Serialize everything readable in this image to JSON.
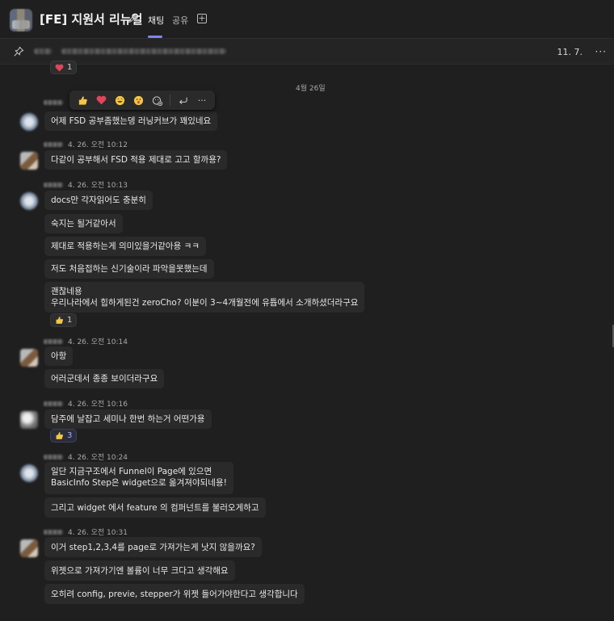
{
  "header": {
    "title": "[FE] 지원서 리뉴얼",
    "tabs": [
      {
        "label": "채팅",
        "active": true
      },
      {
        "label": "공유",
        "active": false
      }
    ],
    "add_tab_symbol": "+"
  },
  "pinned": {
    "date": "11. 7.",
    "more": "···"
  },
  "top_reaction": {
    "emoji": "heart",
    "count": "1"
  },
  "date_divider": "4월 26일",
  "toolbar": {
    "icons": [
      "thumbs-up-icon",
      "heart-icon",
      "laugh-icon",
      "surprised-icon",
      "add-reaction-icon",
      "reply-icon",
      "more-icon"
    ]
  },
  "messages": [
    {
      "time": "",
      "bubbles": [
        "어제 FSD 공부좀했는뎅 러닝커브가 꽤있네요"
      ]
    },
    {
      "time": "4. 26. 오전 10:12",
      "bubbles": [
        "다같이 공부해서 FSD 적용 제대로 고고 할까용?"
      ]
    },
    {
      "time": "4. 26. 오전 10:13",
      "bubbles": [
        "docs만 각자읽어도 충분히",
        "숙지는 될거같아서",
        "제대로 적용하는게 의미있을거같아용 ㅋㅋ",
        "저도 처음접하는 신기술이라 파악을못했는데",
        "괜찮네용",
        "우리나라에서 힙하게된건 zeroCho? 이분이 3~4개월전에 유튭에서 소개하셨더라구요"
      ],
      "reaction": {
        "emoji": "thumbs-up",
        "count": "1"
      }
    },
    {
      "time": "4. 26. 오전 10:14",
      "bubbles": [
        "아항",
        "어러군데서 종종 보이더라구요"
      ]
    },
    {
      "time": "4. 26. 오전 10:16",
      "bubbles": [
        "담주에 날잡고 세미나 한번 하는거 어떤가용"
      ],
      "reaction": {
        "emoji": "thumbs-up",
        "count": "3"
      }
    },
    {
      "time": "4. 26. 오전 10:24",
      "bubbles": [
        "일단 지금구조에서 Funnel이 Page에 있으면",
        "BasicInfo Step은 widget으로 옮겨져야되네용!",
        "그리고 widget 에서 feature 의 컴퍼넌트를 불러오게하고"
      ]
    },
    {
      "time": "4. 26. 오전 10:31",
      "bubbles": [
        "이거 step1,2,3,4를 page로 가져가는게 낫지 않을까요?",
        "위젯으로 가져가기엔 볼륨이 너무 크다고 생각해요",
        "오히려 config, previe, stepper가 위젯 들어가야한다고 생각합니다"
      ]
    }
  ],
  "colors": {
    "background": "#1f1f1f",
    "bubble": "#2a2a2a",
    "accent": "#7f85f5"
  }
}
